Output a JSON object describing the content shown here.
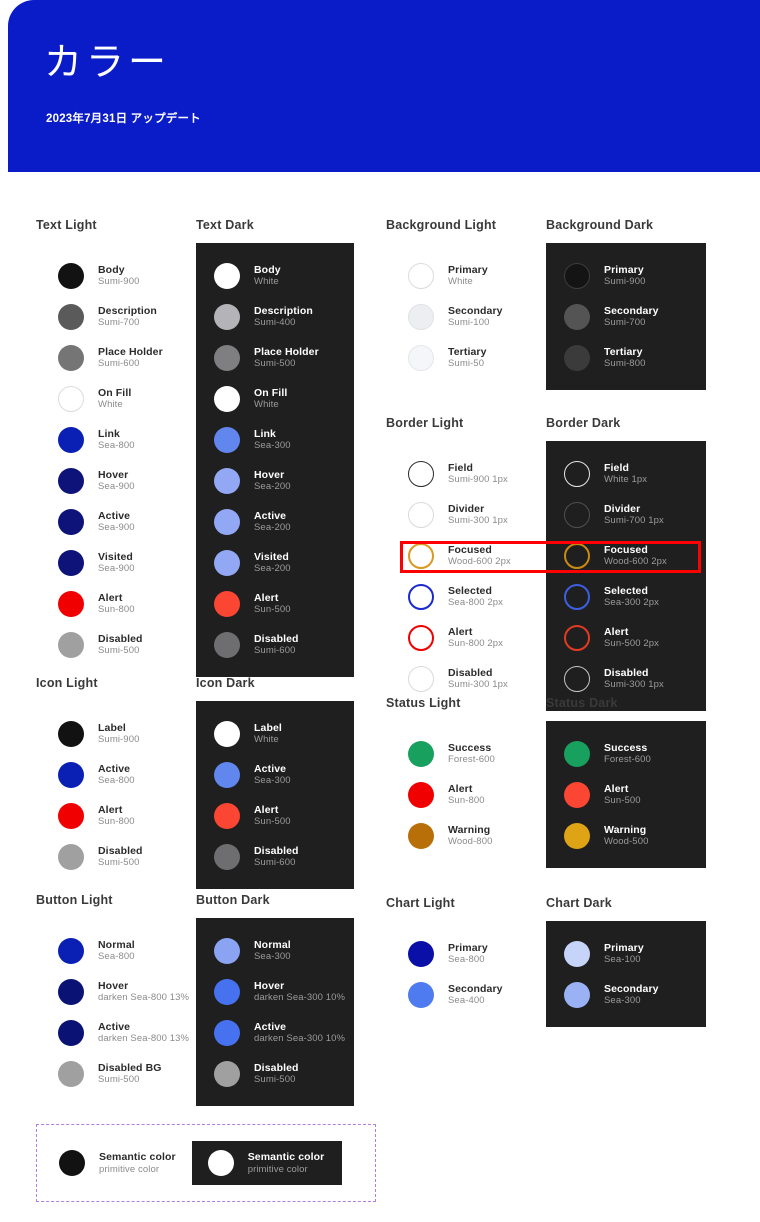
{
  "header": {
    "title": "カラー",
    "subtitle": "2023年7月31日 アップデート",
    "bg_color": "#0a1bc8"
  },
  "theme": {
    "dark_panel_bg": "#1f1f1f",
    "annotation_color": "#ff0000",
    "legend_border_color": "#b17fe0"
  },
  "groups": [
    {
      "id": "text-light",
      "title": "Text Light",
      "mode": "light",
      "items": [
        {
          "name": "Body",
          "value": "Sumi-900",
          "color": "#121212"
        },
        {
          "name": "Description",
          "value": "Sumi-700",
          "color": "#5a5a5a"
        },
        {
          "name": "Place Holder",
          "value": "Sumi-600",
          "color": "#757575"
        },
        {
          "name": "On Fill",
          "value": "White",
          "color": "#ffffff",
          "ring": "#dcdcdc"
        },
        {
          "name": "Link",
          "value": "Sea-800",
          "color": "#0a20b4"
        },
        {
          "name": "Hover",
          "value": "Sea-900",
          "color": "#0d1378"
        },
        {
          "name": "Active",
          "value": "Sea-900",
          "color": "#0d1378"
        },
        {
          "name": "Visited",
          "value": "Sea-900",
          "color": "#0d1378"
        },
        {
          "name": "Alert",
          "value": "Sun-800",
          "color": "#f00000"
        },
        {
          "name": "Disabled",
          "value": "Sumi-500",
          "color": "#a0a0a0"
        }
      ]
    },
    {
      "id": "text-dark",
      "title": "Text Dark",
      "mode": "dark",
      "items": [
        {
          "name": "Body",
          "value": "White",
          "color": "#ffffff"
        },
        {
          "name": "Description",
          "value": "Sumi-400",
          "color": "#b4b4b8"
        },
        {
          "name": "Place Holder",
          "value": "Sumi-500",
          "color": "#7f7f82"
        },
        {
          "name": "On Fill",
          "value": "White",
          "color": "#ffffff"
        },
        {
          "name": "Link",
          "value": "Sea-300",
          "color": "#6186ee"
        },
        {
          "name": "Hover",
          "value": "Sea-200",
          "color": "#92a8f4"
        },
        {
          "name": "Active",
          "value": "Sea-200",
          "color": "#92a8f4"
        },
        {
          "name": "Visited",
          "value": "Sea-200",
          "color": "#92a8f4"
        },
        {
          "name": "Alert",
          "value": "Sun-500",
          "color": "#fa4632"
        },
        {
          "name": "Disabled",
          "value": "Sumi-600",
          "color": "#6e6e70"
        }
      ]
    },
    {
      "id": "background-light",
      "title": "Background Light",
      "mode": "light",
      "items": [
        {
          "name": "Primary",
          "value": "White",
          "color": "#ffffff",
          "ring": "#dcdcdc"
        },
        {
          "name": "Secondary",
          "value": "Sumi-100",
          "color": "#eceef2",
          "ring": "#e0e2e6"
        },
        {
          "name": "Tertiary",
          "value": "Sumi-50",
          "color": "#f5f6f9",
          "ring": "#e4e6ea"
        }
      ]
    },
    {
      "id": "background-dark",
      "title": "Background Dark",
      "mode": "dark",
      "items": [
        {
          "name": "Primary",
          "value": "Sumi-900",
          "color": "#141414",
          "ring": "#3c3c3c"
        },
        {
          "name": "Secondary",
          "value": "Sumi-700",
          "color": "#545454"
        },
        {
          "name": "Tertiary",
          "value": "Sumi-800",
          "color": "#3b3b3b"
        }
      ]
    },
    {
      "id": "border-light",
      "title": "Border Light",
      "mode": "light",
      "outline": true,
      "items": [
        {
          "name": "Field",
          "value": "Sumi-900 1px",
          "color": "#2b2b2b",
          "width": 1.6
        },
        {
          "name": "Divider",
          "value": "Sumi-300 1px",
          "color": "#dadada",
          "width": 1.6
        },
        {
          "name": "Focused",
          "value": "Wood-600 2px",
          "color": "#dd9823",
          "width": 2.4
        },
        {
          "name": "Selected",
          "value": "Sea-800 2px",
          "color": "#1a2ad0",
          "width": 2.4
        },
        {
          "name": "Alert",
          "value": "Sun-800 2px",
          "color": "#f00000",
          "width": 2.4
        },
        {
          "name": "Disabled",
          "value": "Sumi-300 1px",
          "color": "#dadada",
          "width": 1.6
        }
      ]
    },
    {
      "id": "border-dark",
      "title": "Border Dark",
      "mode": "dark",
      "outline": true,
      "items": [
        {
          "name": "Field",
          "value": "White 1px",
          "color": "#e6e6e6",
          "width": 1.6
        },
        {
          "name": "Divider",
          "value": "Sumi-700 1px",
          "color": "#4f4f4f",
          "width": 1.6
        },
        {
          "name": "Focused",
          "value": "Wood-600 2px",
          "color": "#c98a12",
          "width": 2.4
        },
        {
          "name": "Selected",
          "value": "Sea-300 2px",
          "color": "#3d5fe0",
          "width": 2.4
        },
        {
          "name": "Alert",
          "value": "Sun-500 2px",
          "color": "#e33a22",
          "width": 2.4
        },
        {
          "name": "Disabled",
          "value": "Sumi-300 1px",
          "color": "#c4c4c4",
          "width": 1.6
        }
      ]
    },
    {
      "id": "icon-light",
      "title": "Icon Light",
      "mode": "light",
      "items": [
        {
          "name": "Label",
          "value": "Sumi-900",
          "color": "#121212"
        },
        {
          "name": "Active",
          "value": "Sea-800",
          "color": "#0a20b4"
        },
        {
          "name": "Alert",
          "value": "Sun-800",
          "color": "#f00000"
        },
        {
          "name": "Disabled",
          "value": "Sumi-500",
          "color": "#a0a0a0"
        }
      ]
    },
    {
      "id": "icon-dark",
      "title": "Icon Dark",
      "mode": "dark",
      "items": [
        {
          "name": "Label",
          "value": "White",
          "color": "#ffffff"
        },
        {
          "name": "Active",
          "value": "Sea-300",
          "color": "#6186ee"
        },
        {
          "name": "Alert",
          "value": "Sun-500",
          "color": "#fa4632"
        },
        {
          "name": "Disabled",
          "value": "Sumi-600",
          "color": "#6e6e70"
        }
      ]
    },
    {
      "id": "status-light",
      "title": "Status Light",
      "mode": "light",
      "items": [
        {
          "name": "Success",
          "value": "Forest-600",
          "color": "#18a05f"
        },
        {
          "name": "Alert",
          "value": "Sun-800",
          "color": "#f00000"
        },
        {
          "name": "Warning",
          "value": "Wood-800",
          "color": "#b96f08"
        }
      ]
    },
    {
      "id": "status-dark",
      "title": "Status Dark",
      "mode": "dark",
      "items": [
        {
          "name": "Success",
          "value": "Forest-600",
          "color": "#18a05f"
        },
        {
          "name": "Alert",
          "value": "Sun-500",
          "color": "#fa4632"
        },
        {
          "name": "Warning",
          "value": "Wood-500",
          "color": "#dfa316"
        }
      ]
    },
    {
      "id": "button-light",
      "title": "Button Light",
      "mode": "light",
      "items": [
        {
          "name": "Normal",
          "value": "Sea-800",
          "color": "#0a20b4"
        },
        {
          "name": "Hover",
          "value": "darken Sea-800 13%",
          "color": "#0a1273"
        },
        {
          "name": "Active",
          "value": "darken Sea-800 13%",
          "color": "#0a1273"
        },
        {
          "name": "Disabled BG",
          "value": "Sumi-500",
          "color": "#a0a0a0"
        }
      ]
    },
    {
      "id": "button-dark",
      "title": "Button Dark",
      "mode": "dark",
      "items": [
        {
          "name": "Normal",
          "value": "Sea-300",
          "color": "#8aa3f2"
        },
        {
          "name": "Hover",
          "value": "darken Sea-300 10%",
          "color": "#4772ef"
        },
        {
          "name": "Active",
          "value": "darken Sea-300 10%",
          "color": "#4772ef"
        },
        {
          "name": "Disabled",
          "value": "Sumi-500",
          "color": "#a0a0a0"
        }
      ]
    },
    {
      "id": "chart-light",
      "title": "Chart Light",
      "mode": "light",
      "items": [
        {
          "name": "Primary",
          "value": "Sea-800",
          "color": "#0a0fa8"
        },
        {
          "name": "Secondary",
          "value": "Sea-400",
          "color": "#4f7bf0"
        }
      ]
    },
    {
      "id": "chart-dark",
      "title": "Chart Dark",
      "mode": "dark",
      "items": [
        {
          "name": "Primary",
          "value": "Sea-100",
          "color": "#c5d4f8"
        },
        {
          "name": "Secondary",
          "value": "Sea-300",
          "color": "#9ab1f3"
        }
      ]
    }
  ],
  "legend": {
    "light": {
      "name": "Semantic color",
      "value": "primitive color",
      "color": "#121212"
    },
    "dark": {
      "name": "Semantic color",
      "value": "primitive color",
      "color": "#ffffff"
    }
  }
}
